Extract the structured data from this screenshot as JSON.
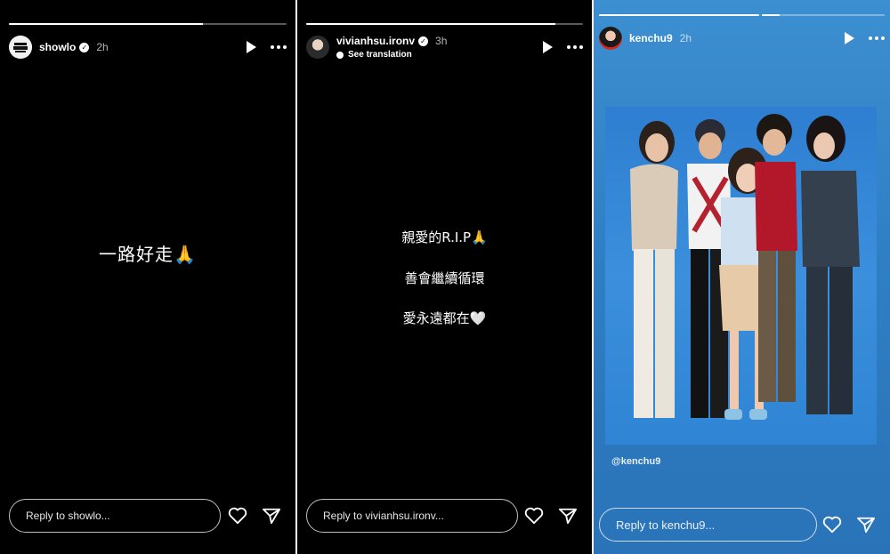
{
  "stories": [
    {
      "username": "showlo",
      "time": "2h",
      "progress": 0.7,
      "caption_lines": [
        "一路好走🙏"
      ],
      "reply_placeholder": "Reply to showlo..."
    },
    {
      "username": "vivianhsu.ironv",
      "time": "3h",
      "progress": 0.9,
      "see_translation": "See translation",
      "caption_lines": [
        "親愛的R.I.P🙏",
        "善會繼續循環",
        "愛永遠都在🤍"
      ],
      "reply_placeholder": "Reply to vivianhsu.ironv..."
    },
    {
      "username": "kenchu9",
      "time": "2h",
      "progress_segments": [
        1.0,
        0.15
      ],
      "mention": "@kenchu9",
      "reply_placeholder": "Reply to kenchu9..."
    }
  ],
  "icons": {
    "play": "play-icon",
    "more": "more-options-icon",
    "like": "heart-icon",
    "share": "send-icon",
    "verified": "verified-badge-icon"
  },
  "colors": {
    "dark_bg": "#000000",
    "blue_bg": "#2f7fc4",
    "photo_bg": "#3b8fdc"
  }
}
